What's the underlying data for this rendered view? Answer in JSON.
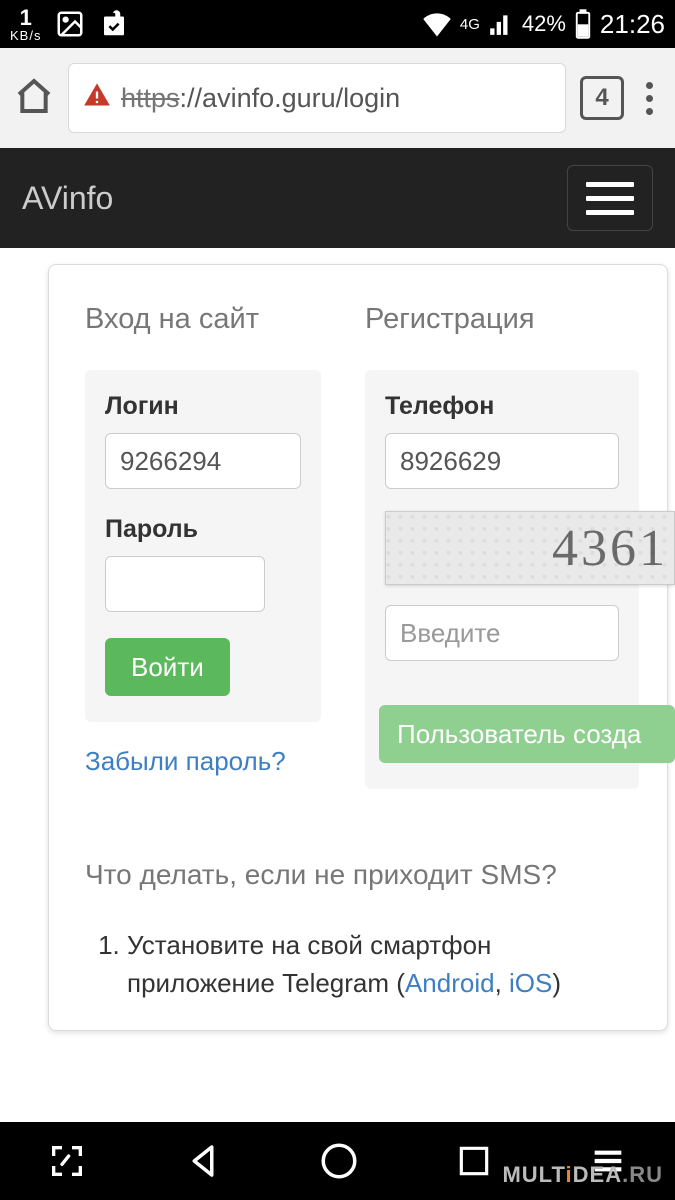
{
  "status": {
    "kbps_value": "1",
    "kbps_unit": "KB/s",
    "net_label": "4G",
    "battery_pct": "42%",
    "clock": "21:26"
  },
  "browser": {
    "url_scheme": "https",
    "url_rest": "://avinfo.guru/login",
    "tab_count": "4"
  },
  "site": {
    "brand": "AVinfo"
  },
  "login": {
    "section_title": "Вход на сайт",
    "login_label": "Логин",
    "login_value": "9266294",
    "password_label": "Пароль",
    "password_value": "",
    "submit_label": "Войти",
    "forgot_link": "Забыли пароль?"
  },
  "register": {
    "section_title": "Регистрация",
    "phone_label": "Телефон",
    "phone_value": "8926629",
    "captcha_text": "4361",
    "captcha_placeholder": "Введите",
    "toast": "Пользователь созда"
  },
  "faq": {
    "title": "Что делать, если не приходит SMS?",
    "item1_a": "Установите на свой смартфон приложение Telegram (",
    "item1_android": "Android",
    "item1_sep": ", ",
    "item1_ios": "iOS",
    "item1_b": ")"
  },
  "watermark": {
    "a": "MULT",
    "i": "i",
    "b": "DEA",
    "c": ".RU"
  }
}
